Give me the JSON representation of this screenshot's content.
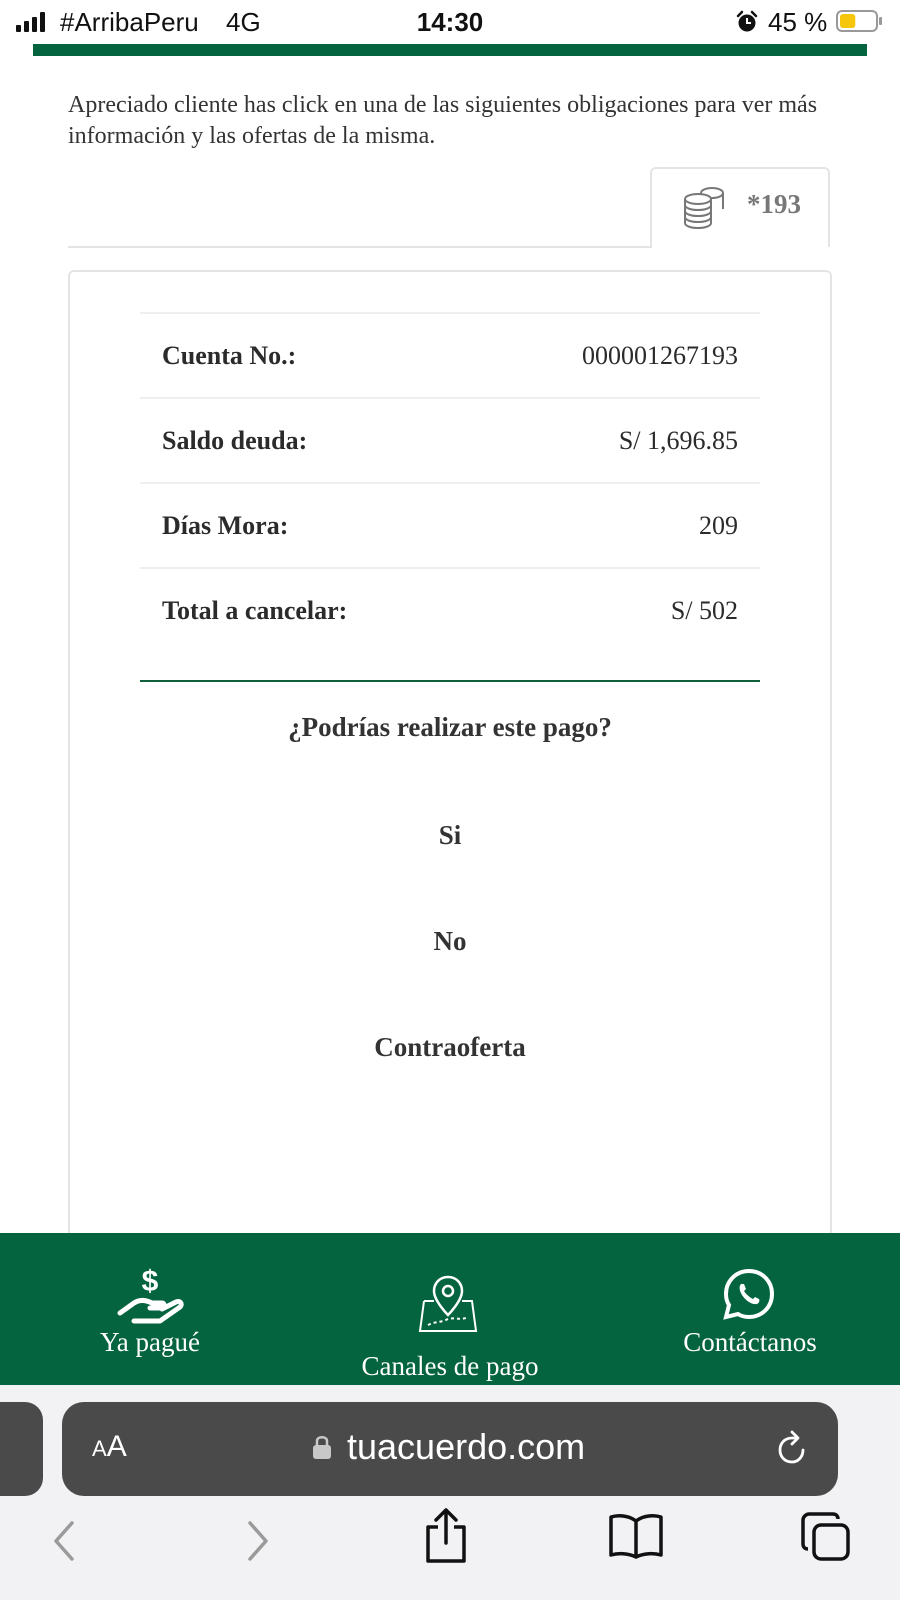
{
  "status_bar": {
    "carrier": "#ArribaPeru",
    "network": "4G",
    "time": "14:30",
    "battery_percent": "45 %",
    "battery_level": 0.45,
    "alarm_icon": "alarm-clock-icon"
  },
  "intro_text": "Apreciado cliente has click en una de las siguientes obligaciones para ver más información y las ofertas de la misma.",
  "account_tab": {
    "icon": "coins-stack-icon",
    "label": "*193"
  },
  "account_details": [
    {
      "label": "Cuenta No.:",
      "value": "000001267193"
    },
    {
      "label": "Saldo deuda:",
      "value": "S/ 1,696.85"
    },
    {
      "label": "Días Mora:",
      "value": "209"
    },
    {
      "label": "Total a cancelar:",
      "value": "S/ 502"
    }
  ],
  "question": "¿Podrías realizar este pago?",
  "options": [
    "Si",
    "No",
    "Contraoferta"
  ],
  "bottom_nav": [
    {
      "label": "Ya pagué",
      "icon": "hand-dollar-icon"
    },
    {
      "label": "Canales de pago",
      "icon": "map-pin-icon"
    },
    {
      "label": "Contáctanos",
      "icon": "whatsapp-icon"
    }
  ],
  "browser": {
    "aa_label": "AA",
    "url": "tuacuerdo.com",
    "icons": [
      "lock-icon",
      "reload-icon",
      "back-icon",
      "forward-icon",
      "share-icon",
      "bookmarks-icon",
      "tabs-icon"
    ]
  },
  "colors": {
    "brand_green": "#04643f",
    "divider_green": "#0f5e3c",
    "battery_yellow": "#f6c60a"
  }
}
